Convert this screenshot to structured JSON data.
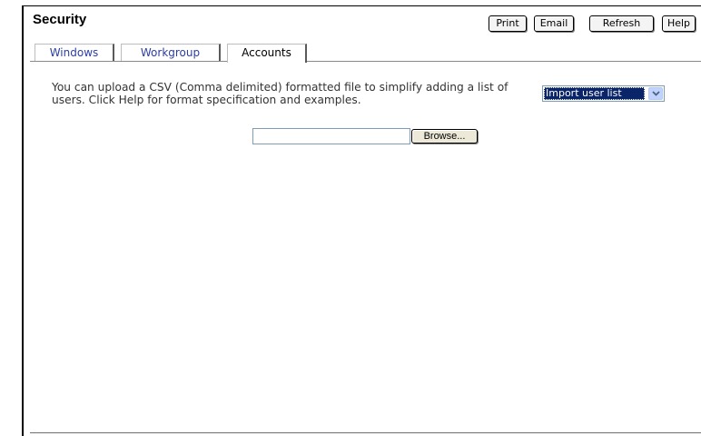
{
  "header": {
    "title": "Security"
  },
  "toolbar": {
    "print_label": "Print",
    "email_label": "Email",
    "refresh_label": "Refresh",
    "help_label": "Help"
  },
  "tabs": [
    {
      "label": "Windows",
      "active": false
    },
    {
      "label": "Workgroup",
      "active": false
    },
    {
      "label": "Accounts",
      "active": true
    }
  ],
  "accounts": {
    "description": "You can upload a CSV (Comma delimited) formatted file to simplify adding a list of users. Click Help for format specification and examples.",
    "import_select": {
      "selected": "Import user list"
    },
    "file_input": {
      "value": ""
    },
    "browse_label": "Browse..."
  },
  "colors": {
    "tab_link": "#2b3fa3",
    "selection": "#0a246a"
  },
  "icons": {
    "select_arrow": "chevron-down-icon"
  }
}
